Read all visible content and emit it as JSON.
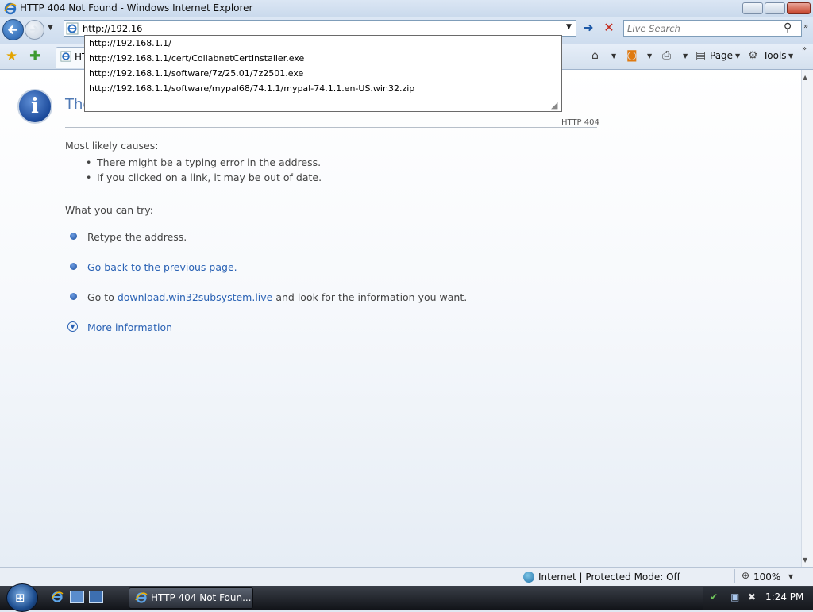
{
  "window": {
    "title": "HTTP 404 Not Found - Windows Internet Explorer"
  },
  "address_bar": {
    "value": "http://192.16",
    "autocomplete": [
      "http://192.168.1.1/",
      "http://192.168.1.1/cert/CollabnetCertInstaller.exe",
      "http://192.168.1.1/software/7z/25.01/7z2501.exe",
      "http://192.168.1.1/software/mypal68/74.1.1/mypal-74.1.1.en-US.win32.zip"
    ]
  },
  "search": {
    "placeholder": "Live Search"
  },
  "tab": {
    "label": "HT"
  },
  "command_bar": {
    "page_label": "Page",
    "tools_label": "Tools"
  },
  "page": {
    "heading": "The",
    "http_code": "HTTP 404",
    "causes_label": "Most likely causes:",
    "causes": [
      "There might be a typing error in the address.",
      "If you clicked on a link, it may be out of date."
    ],
    "try_label": "What you can try:",
    "retype": "Retype the address.",
    "go_back": "Go back to the previous page.",
    "go_to_prefix": "Go to",
    "go_to_link": "download.win32subsystem.live",
    "go_to_suffix": "and look for the information you want.",
    "more_info": "More information"
  },
  "status_bar": {
    "zone": "Internet | Protected Mode: Off",
    "zoom": "100%"
  },
  "taskbar": {
    "task_label": "HTTP 404 Not Foun...",
    "clock": "1:24 PM"
  },
  "icons": {
    "back": "back-arrow-icon",
    "forward": "forward-arrow-icon",
    "ie": "internet-explorer-icon",
    "go": "go-arrow-icon",
    "stop": "stop-x-icon",
    "search": "magnifier-icon",
    "favorites": "star-icon",
    "add_favorites": "add-star-icon",
    "home": "home-icon",
    "feeds": "rss-feed-icon",
    "print": "printer-icon",
    "page": "page-icon",
    "tools": "gear-icon",
    "info": "information-icon",
    "globe": "globe-icon",
    "zoom": "zoom-magnifier-icon"
  },
  "colors": {
    "link": "#2a62b4",
    "heading": "#4f79b5",
    "stop": "#c42a1c"
  }
}
